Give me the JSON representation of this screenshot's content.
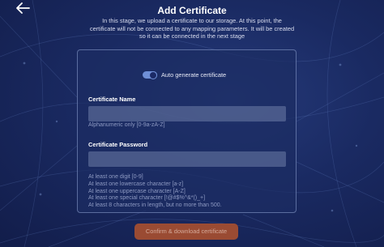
{
  "header": {
    "back_icon": "arrow-left-icon",
    "title": "Add Certificate",
    "description_lines": [
      "In this stage, we upload a certificate to our storage. At this point, the",
      "certificate will not be connected to any mapping parameters. It will be created",
      "so it can be connected in the next stage"
    ]
  },
  "form": {
    "auto_generate": {
      "label": "Auto generate certificate",
      "enabled": true
    },
    "certificate_name": {
      "label": "Certificate Name",
      "value": "",
      "hint": "Alphanumeric only [0-9a-zA-Z]"
    },
    "certificate_password": {
      "label": "Certificate Password",
      "value": "",
      "rules": [
        "At least one digit [0-9]",
        "At least one lowercase character [a-z]",
        "At least one uppercase character [A-Z]",
        "At least one special character [!@#$%^&*()_+]",
        "At least 8 characters in length, but no more than 500."
      ]
    }
  },
  "actions": {
    "confirm_label": "Confirm & download certificate"
  },
  "colors": {
    "background": "#1a2a62",
    "card": "#1c2c62",
    "toggle_on": "#6f8fd6",
    "confirm_button": "#9a4b33"
  }
}
